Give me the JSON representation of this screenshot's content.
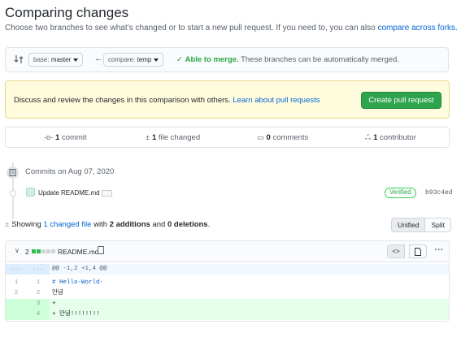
{
  "header": {
    "title": "Comparing changes",
    "subtitle": "Choose two branches to see what’s changed or to start a new pull request. If you need to, you can also ",
    "subtitle_link": "compare across forks."
  },
  "range": {
    "base_prefix": "base:",
    "base_value": "master",
    "compare_prefix": "compare:",
    "compare_value": "temp",
    "merge_status": "Able to merge.",
    "merge_detail": "These branches can be automatically merged."
  },
  "flash": {
    "message": "Discuss and review the changes in this comparison with others. ",
    "link": "Learn about pull requests",
    "button": "Create pull request"
  },
  "summary": {
    "commits_count": "1",
    "commits_label": "commit",
    "files_count": "1",
    "files_label": "file changed",
    "comments_count": "0",
    "comments_label": "comments",
    "contributors_count": "1",
    "contributors_label": "contributor"
  },
  "timeline": {
    "commits_on": "Commits on Aug 07, 2020",
    "commit_message": "Update README.md",
    "verified": "Verified",
    "sha": "b93c4ed"
  },
  "toc": {
    "showing": "Showing ",
    "changed_files": "1 changed file",
    "with": " with ",
    "additions": "2 additions",
    "and": " and ",
    "deletions": "0 deletions",
    "end": "."
  },
  "view": {
    "unified": "Unified",
    "split": "Split"
  },
  "file": {
    "change_count": "2",
    "name": "README.md",
    "more": "···",
    "hunk_left": "...",
    "hunk_right": "...",
    "hunk_header": "@@ -1,2 +1,4 @@",
    "lines": [
      {
        "old": "1",
        "new": "1",
        "code": "  # Hello-World-"
      },
      {
        "old": "2",
        "new": "2",
        "code": "  안녕"
      },
      {
        "old": "",
        "new": "3",
        "code": "+"
      },
      {
        "old": "",
        "new": "4",
        "code": "+ 안녕!!!!!!!!"
      }
    ]
  },
  "icons": [
    "git-compare-icon",
    "arrow-left-icon",
    "check-icon",
    "commit-icon",
    "diff-icon",
    "comment-icon",
    "people-icon",
    "repo-push-icon",
    "clippy-icon",
    "code-icon",
    "file-icon",
    "kebab-icon",
    "chevron-down-icon"
  ],
  "colors": {
    "link": "#0366d6",
    "success": "#28a745",
    "flash_bg": "#fffbdd",
    "add_bg": "#e6ffed",
    "hunk_bg": "#f1f8ff"
  }
}
